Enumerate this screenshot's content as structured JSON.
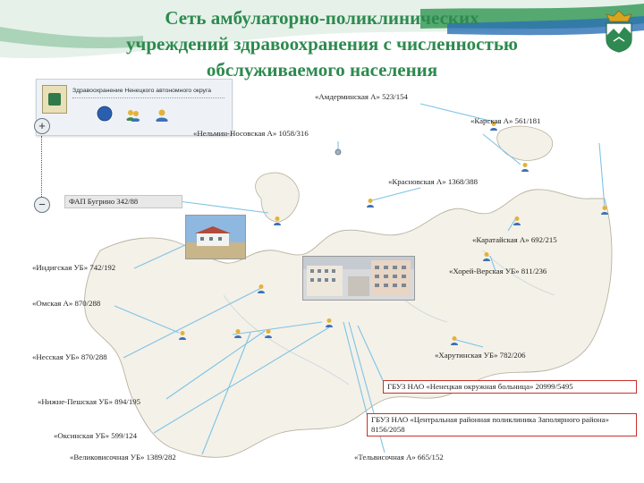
{
  "title": {
    "lines": [
      "Сеть амбулаторно-поликлинических",
      "учреждений здравоохранения с численностью",
      "обслуживаемого населения"
    ]
  },
  "portal": {
    "header": "Здравоохранение Ненецкого автономного округа"
  },
  "colors": {
    "title": "#2d8a4e",
    "land": "#f4f1e8",
    "land_border": "#b8b2a2",
    "leader": "#7dc3e6",
    "box_border": "#c8302e",
    "wave_green": "#3a9b5a",
    "wave_blue": "#2a6fb5"
  },
  "zoom": {
    "plus": "+",
    "minus": "−"
  },
  "facilities": [
    {
      "id": "amderma",
      "label": "«Амдерминская А» 523/154"
    },
    {
      "id": "karskaya",
      "label": "«Карская А» 561/181"
    },
    {
      "id": "nelmin",
      "label": "«Нельмин-Носовская А» 1058/316"
    },
    {
      "id": "krasnovskaya",
      "label": "«Красновская А» 1368/388"
    },
    {
      "id": "butrino",
      "label": "ФАП Бугрино 342/88"
    },
    {
      "id": "karatayka",
      "label": "«Каратайская А» 692/215"
    },
    {
      "id": "indiga",
      "label": "«Индигская УБ» 742/192"
    },
    {
      "id": "horey",
      "label": "«Хорей-Верская УБ» 811/236"
    },
    {
      "id": "omskaya",
      "label": "«Омская А» 870/288"
    },
    {
      "id": "nesskaya",
      "label": "«Несская УБ» 870/288"
    },
    {
      "id": "harutinskaya",
      "label": "«Харутинская УБ» 782/206"
    },
    {
      "id": "gbuz_hospital",
      "label": "ГБУЗ НАО «Ненецкая окружная больница» 20999/5495"
    },
    {
      "id": "nizhne_pesha",
      "label": "«Нижне-Пешская УБ» 894/195"
    },
    {
      "id": "gbuz_polyclinic",
      "label": "ГБУЗ НАО «Центральная районная поликлиника Заполярного района» 8156/2058"
    },
    {
      "id": "oksino",
      "label": "«Оксинская УБ» 599/124"
    },
    {
      "id": "velikovisochnoe",
      "label": "«Великовисочная УБ» 1389/282"
    },
    {
      "id": "telvisochnaya",
      "label": "«Тельвисочная А» 665/152"
    }
  ]
}
